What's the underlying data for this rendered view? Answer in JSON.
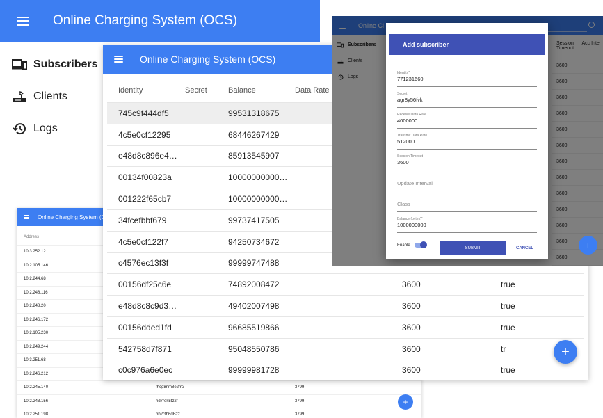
{
  "app": {
    "title": "Online Charging System (OCS)",
    "title_truncated": "Online Charging System (C",
    "title_short": "Online Cl"
  },
  "nav": {
    "subscribers": "Subscribers",
    "clients": "Clients",
    "logs": "Logs"
  },
  "subscribers_table": {
    "headers": {
      "identity": "Identity",
      "secret": "Secret",
      "balance": "Balance",
      "data_rate": "Data Rate"
    },
    "rows": [
      {
        "identity": "745c9f444df5",
        "balance": "99531318675",
        "timeout": "",
        "enabled": ""
      },
      {
        "identity": "4c5e0cf12295",
        "balance": "68446267429",
        "timeout": "",
        "enabled": ""
      },
      {
        "identity": "e48d8c896e4…",
        "balance": "85913545907",
        "timeout": "",
        "enabled": ""
      },
      {
        "identity": "00134f00823a",
        "balance": "10000000000…",
        "timeout": "",
        "enabled": ""
      },
      {
        "identity": "001222f65cb7",
        "balance": "10000000000…",
        "timeout": "",
        "enabled": ""
      },
      {
        "identity": "34fcefbbf679",
        "balance": "99737417505",
        "timeout": "",
        "enabled": ""
      },
      {
        "identity": "4c5e0cf122f7",
        "balance": "94250734672",
        "timeout": "",
        "enabled": ""
      },
      {
        "identity": "c4576ec13f3f",
        "balance": "99999747488",
        "timeout": "",
        "enabled": ""
      },
      {
        "identity": "00156df25c6e",
        "balance": "74892008472",
        "timeout": "3600",
        "enabled": "true"
      },
      {
        "identity": "e48d8c8c9d3…",
        "balance": "49402007498",
        "timeout": "3600",
        "enabled": "true"
      },
      {
        "identity": "00156dded1fd",
        "balance": "96685519866",
        "timeout": "3600",
        "enabled": "true"
      },
      {
        "identity": "542758d7f871",
        "balance": "95048550786",
        "timeout": "3600",
        "enabled": "tr"
      },
      {
        "identity": "c0c976a6e0ec",
        "balance": "99999981728",
        "timeout": "3600",
        "enabled": "true"
      }
    ]
  },
  "clients_table": {
    "header": "Address",
    "rows": [
      {
        "address": "10.3.252.12",
        "secret": "",
        "timeout": ""
      },
      {
        "address": "10.2.105.146",
        "secret": "",
        "timeout": ""
      },
      {
        "address": "10.2.244.68",
        "secret": "",
        "timeout": ""
      },
      {
        "address": "10.2.248.116",
        "secret": "",
        "timeout": ""
      },
      {
        "address": "10.2.248.20",
        "secret": "",
        "timeout": ""
      },
      {
        "address": "10.2.246.172",
        "secret": "",
        "timeout": ""
      },
      {
        "address": "10.2.105.230",
        "secret": "",
        "timeout": ""
      },
      {
        "address": "10.2.249.244",
        "secret": "",
        "timeout": ""
      },
      {
        "address": "10.3.251.68",
        "secret": "",
        "timeout": ""
      },
      {
        "address": "10.2.246.212",
        "secret": "",
        "timeout": ""
      },
      {
        "address": "10.2.245.140",
        "secret": "fhcg8nm8e2m3",
        "timeout": "3799"
      },
      {
        "address": "10.2.243.156",
        "secret": "hd7rek5tz2r",
        "timeout": "3799"
      },
      {
        "address": "10.2.251.198",
        "secret": "bb2cfh6dBzz",
        "timeout": "3799"
      }
    ]
  },
  "dialog_bg_table": {
    "header": [
      "Session Timeout",
      "Acc Inte"
    ],
    "values": [
      "3600",
      "3600",
      "3600",
      "3600",
      "3600",
      "3600",
      "3600",
      "3600",
      "3600",
      "3600",
      "3600",
      "3600",
      "3600"
    ]
  },
  "dialog": {
    "title": "Add subscriber",
    "fields": [
      {
        "label": "Identity*",
        "value": "771231660"
      },
      {
        "label": "Secret",
        "value": "agr8y56fvk"
      },
      {
        "label": "Receive Data Rate",
        "value": "4000000"
      },
      {
        "label": "Transmit Data Rate",
        "value": "512000"
      },
      {
        "label": "Session Timeout",
        "value": "3600"
      },
      {
        "label": "",
        "placeholder": "Update Interval"
      },
      {
        "label": "",
        "placeholder": "Class"
      },
      {
        "label": "Balance (bytes)*",
        "value": "1000000000"
      }
    ],
    "enable_label": "Enable",
    "enable_on": true,
    "submit": "SUBMIT",
    "cancel": "CANCEL"
  },
  "fab_label": "+",
  "colors": {
    "appbar": "#3d7ef2",
    "dialog_accent": "#3f51b5"
  }
}
